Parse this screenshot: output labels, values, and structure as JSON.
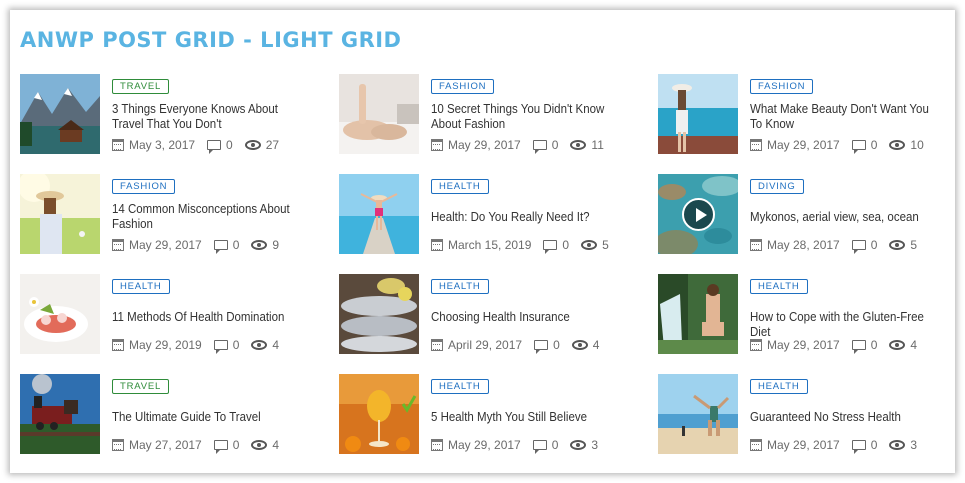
{
  "page_title": "ANWP POST GRID - LIGHT GRID",
  "posts": [
    {
      "category": "TRAVEL",
      "title": "3 Things Everyone Knows About Travel That You Don't",
      "date": "May 3, 2017",
      "comments": "0",
      "views": "27",
      "image": "mountain-lake-boathouse"
    },
    {
      "category": "FASHION",
      "title": "10 Secret Things You Didn't Know About Fashion",
      "date": "May 29, 2017",
      "comments": "0",
      "views": "11",
      "image": "woman-lying-in-bed"
    },
    {
      "category": "FASHION",
      "title": "What Make Beauty Don't Want You To Know",
      "date": "May 29, 2017",
      "comments": "0",
      "views": "10",
      "image": "woman-with-hat-by-sea"
    },
    {
      "category": "FASHION",
      "title": "14 Common Misconceptions About Fashion",
      "date": "May 29, 2017",
      "comments": "0",
      "views": "9",
      "image": "woman-in-sunny-meadow"
    },
    {
      "category": "HEALTH",
      "title": "Health: Do You Really Need It?",
      "date": "March 15, 2019",
      "comments": "0",
      "views": "5",
      "image": "woman-on-pier"
    },
    {
      "category": "DIVING",
      "title": "Mykonos, aerial view, sea, ocean",
      "date": "May 28, 2017",
      "comments": "0",
      "views": "5",
      "image": "aerial-sea-view",
      "video": true
    },
    {
      "category": "HEALTH",
      "title": "11 Methods Of Health Domination",
      "date": "May 29, 2019",
      "comments": "0",
      "views": "4",
      "image": "salad-plate"
    },
    {
      "category": "HEALTH",
      "title": "Choosing Health Insurance",
      "date": "April 29, 2017",
      "comments": "0",
      "views": "4",
      "image": "fish-on-ice"
    },
    {
      "category": "HEALTH",
      "title": "How to Cope with the Gluten-Free Diet",
      "date": "May 29, 2017",
      "comments": "0",
      "views": "4",
      "image": "woman-by-waterfall"
    },
    {
      "category": "TRAVEL",
      "title": "The Ultimate Guide To Travel",
      "date": "May 27, 2017",
      "comments": "0",
      "views": "4",
      "image": "steam-train"
    },
    {
      "category": "HEALTH",
      "title": "5 Health Myth You Still Believe",
      "date": "May 29, 2017",
      "comments": "0",
      "views": "3",
      "image": "orange-juice-glass"
    },
    {
      "category": "HEALTH",
      "title": "Guaranteed No Stress Health",
      "date": "May 29, 2017",
      "comments": "0",
      "views": "3",
      "image": "beach-handstand"
    }
  ],
  "colors": {
    "title": "#5ab4e2",
    "travel_badge": "#2f8c3a",
    "category_badge": "#1e6fc0"
  },
  "icons": {
    "date": "calendar-icon",
    "comments": "comment-icon",
    "views": "eye-icon",
    "video": "play-icon"
  }
}
